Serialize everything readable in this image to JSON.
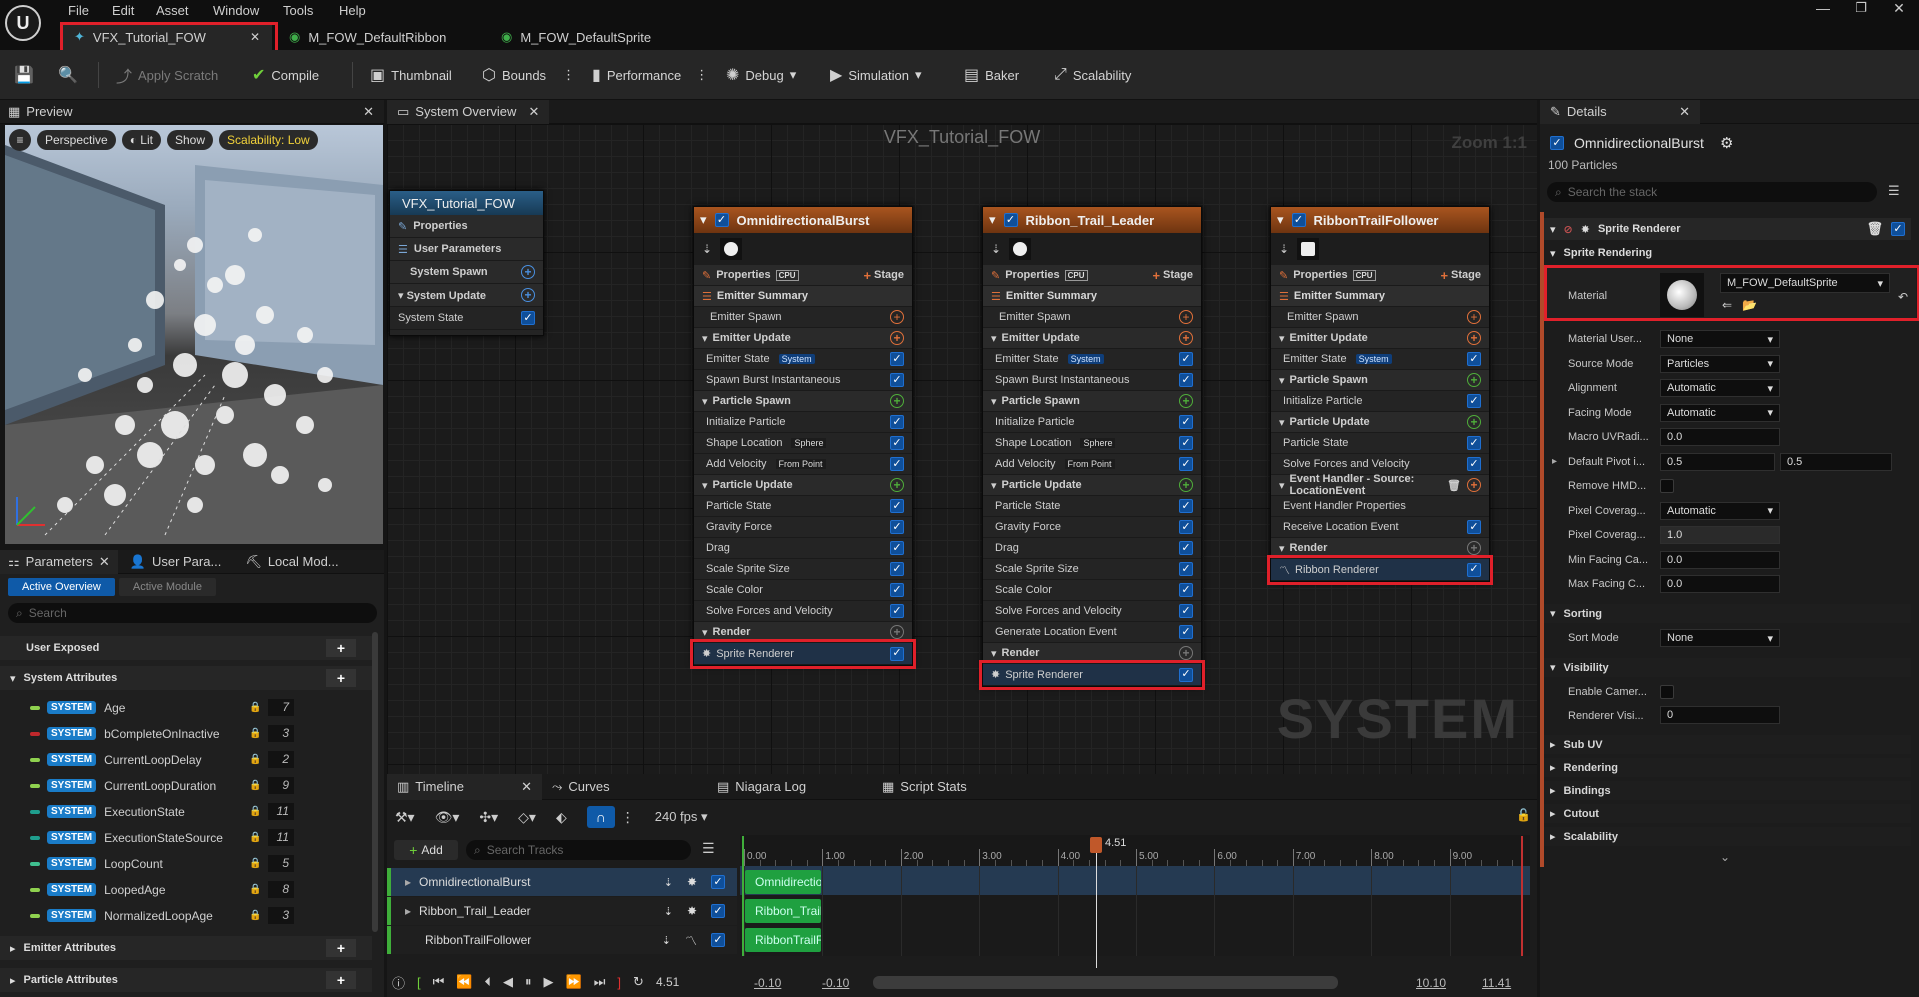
{
  "app": {
    "menu": [
      "File",
      "Edit",
      "Asset",
      "Window",
      "Tools",
      "Help"
    ],
    "tabs": [
      {
        "label": "VFX_Tutorial_FOW",
        "active": true
      },
      {
        "label": "M_FOW_DefaultRibbon",
        "active": false
      },
      {
        "label": "M_FOW_DefaultSprite",
        "active": false
      }
    ]
  },
  "toolbar": {
    "apply_scratch": "Apply Scratch",
    "compile": "Compile",
    "thumbnail": "Thumbnail",
    "bounds": "Bounds",
    "performance": "Performance",
    "debug": "Debug",
    "simulation": "Simulation",
    "baker": "Baker",
    "scalability": "Scalability"
  },
  "preview": {
    "title": "Preview",
    "perspective": "Perspective",
    "lit": "Lit",
    "show": "Show",
    "scalability": "Scalability: Low"
  },
  "parameters": {
    "tabs": [
      "Parameters",
      "User Para...",
      "Local Mod..."
    ],
    "subtabs": [
      "Active Overview",
      "Active Module"
    ],
    "search_placeholder": "Search",
    "user_exposed": "User Exposed",
    "system_attributes": "System Attributes",
    "badge": "SYSTEM",
    "attributes": [
      {
        "name": "Age",
        "value": "7",
        "color": "#8fd14f"
      },
      {
        "name": "bCompleteOnInactive",
        "value": "3",
        "color": "#c0282c"
      },
      {
        "name": "CurrentLoopDelay",
        "value": "2",
        "color": "#8fd14f"
      },
      {
        "name": "CurrentLoopDuration",
        "value": "9",
        "color": "#8fd14f"
      },
      {
        "name": "ExecutionState",
        "value": "11",
        "color": "#1f9e8e"
      },
      {
        "name": "ExecutionStateSource",
        "value": "11",
        "color": "#1f9e8e"
      },
      {
        "name": "LoopCount",
        "value": "5",
        "color": "#3fbf8f"
      },
      {
        "name": "LoopedAge",
        "value": "8",
        "color": "#8fd14f"
      },
      {
        "name": "NormalizedLoopAge",
        "value": "3",
        "color": "#8fd14f"
      }
    ],
    "emitter_attributes": "Emitter Attributes",
    "particle_attributes": "Particle Attributes"
  },
  "overview": {
    "tab": "System Overview",
    "graph_title": "VFX_Tutorial_FOW",
    "zoom": "Zoom 1:1",
    "watermark": "SYSTEM",
    "system_node": {
      "title": "VFX_Tutorial_FOW",
      "rows": [
        "Properties",
        "User Parameters",
        "System Spawn",
        "System Update",
        "System State"
      ]
    },
    "emitters": [
      {
        "title": "OmnidirectionalBurst",
        "properties": "Properties",
        "cpu": "CPU",
        "stage": "Stage",
        "rows": [
          {
            "t": "sec",
            "label": "Emitter Summary"
          },
          {
            "t": "item",
            "label": "Emitter Spawn",
            "plus": "r"
          },
          {
            "t": "grp",
            "label": "Emitter Update",
            "plus": "r"
          },
          {
            "t": "item",
            "label": "Emitter State",
            "pill": "System",
            "chk": true
          },
          {
            "t": "item",
            "label": "Spawn Burst Instantaneous",
            "chk": true
          },
          {
            "t": "grp",
            "label": "Particle Spawn",
            "plus": "g"
          },
          {
            "t": "item",
            "label": "Initialize Particle",
            "chk": true
          },
          {
            "t": "item",
            "label": "Shape Location",
            "pill2": "Sphere",
            "chk": true
          },
          {
            "t": "item",
            "label": "Add Velocity",
            "pill2": "From Point",
            "chk": true
          },
          {
            "t": "grp",
            "label": "Particle Update",
            "plus": "g"
          },
          {
            "t": "item",
            "label": "Particle State",
            "chk": true
          },
          {
            "t": "item",
            "label": "Gravity Force",
            "chk": true
          },
          {
            "t": "item",
            "label": "Drag",
            "chk": true
          },
          {
            "t": "item",
            "label": "Scale Sprite Size",
            "chk": true
          },
          {
            "t": "item",
            "label": "Scale Color",
            "chk": true
          },
          {
            "t": "item",
            "label": "Solve Forces and Velocity",
            "chk": true
          },
          {
            "t": "grp",
            "label": "Render",
            "plus": "gr"
          },
          {
            "t": "render",
            "label": "Sprite Renderer",
            "chk": true
          }
        ]
      },
      {
        "title": "Ribbon_Trail_Leader",
        "properties": "Properties",
        "cpu": "CPU",
        "stage": "Stage",
        "rows": [
          {
            "t": "sec",
            "label": "Emitter Summary"
          },
          {
            "t": "item",
            "label": "Emitter Spawn",
            "plus": "r"
          },
          {
            "t": "grp",
            "label": "Emitter Update",
            "plus": "r"
          },
          {
            "t": "item",
            "label": "Emitter State",
            "pill": "System",
            "chk": true
          },
          {
            "t": "item",
            "label": "Spawn Burst Instantaneous",
            "chk": true
          },
          {
            "t": "grp",
            "label": "Particle Spawn",
            "plus": "g"
          },
          {
            "t": "item",
            "label": "Initialize Particle",
            "chk": true
          },
          {
            "t": "item",
            "label": "Shape Location",
            "pill2": "Sphere",
            "chk": true
          },
          {
            "t": "item",
            "label": "Add Velocity",
            "pill2": "From Point",
            "chk": true
          },
          {
            "t": "grp",
            "label": "Particle Update",
            "plus": "g"
          },
          {
            "t": "item",
            "label": "Particle State",
            "chk": true
          },
          {
            "t": "item",
            "label": "Gravity Force",
            "chk": true
          },
          {
            "t": "item",
            "label": "Drag",
            "chk": true
          },
          {
            "t": "item",
            "label": "Scale Sprite Size",
            "chk": true
          },
          {
            "t": "item",
            "label": "Scale Color",
            "chk": true
          },
          {
            "t": "item",
            "label": "Solve Forces and Velocity",
            "chk": true
          },
          {
            "t": "item",
            "label": "Generate Location Event",
            "chk": true
          },
          {
            "t": "grp",
            "label": "Render",
            "plus": "gr"
          },
          {
            "t": "render",
            "label": "Sprite Renderer",
            "chk": true
          }
        ]
      },
      {
        "title": "RibbonTrailFollower",
        "properties": "Properties",
        "cpu": "CPU",
        "stage": "Stage",
        "rows": [
          {
            "t": "sec",
            "label": "Emitter Summary"
          },
          {
            "t": "item",
            "label": "Emitter Spawn",
            "plus": "r"
          },
          {
            "t": "grp",
            "label": "Emitter Update",
            "plus": "r"
          },
          {
            "t": "item",
            "label": "Emitter State",
            "pill": "System",
            "chk": true
          },
          {
            "t": "grp",
            "label": "Particle Spawn",
            "plus": "g"
          },
          {
            "t": "item",
            "label": "Initialize Particle",
            "chk": true
          },
          {
            "t": "grp",
            "label": "Particle Update",
            "plus": "g"
          },
          {
            "t": "item",
            "label": "Particle State",
            "chk": true
          },
          {
            "t": "item",
            "label": "Solve Forces and Velocity",
            "chk": true
          },
          {
            "t": "grp",
            "label": "Event Handler - Source: LocationEvent",
            "trash": true
          },
          {
            "t": "item",
            "label": "Event Handler Properties"
          },
          {
            "t": "item",
            "label": "Receive Location Event",
            "chk": true
          },
          {
            "t": "grp",
            "label": "Render",
            "plus": "gr"
          },
          {
            "t": "render",
            "label": "Ribbon Renderer",
            "chk": true
          }
        ]
      }
    ]
  },
  "timeline": {
    "tabs": [
      "Timeline",
      "Curves",
      "Niagara Log",
      "Script Stats"
    ],
    "fps": "240 fps",
    "add": "Add",
    "search_placeholder": "Search Tracks",
    "tracks": [
      "OmnidirectionalBurst",
      "Ribbon_Trail_Leader",
      "RibbonTrailFollower"
    ],
    "track_bars": [
      "OmnidirectionalBurst",
      "Ribbon_Trail_Leader",
      "RibbonTrailFollower"
    ],
    "ticks": [
      "0.00",
      "1.00",
      "2.00",
      "3.00",
      "4.00",
      "5.00",
      "6.00",
      "7.00",
      "8.00",
      "9.00"
    ],
    "playhead": "4.51",
    "current_time": "4.51",
    "range_start": "-0.10",
    "view_start": "-0.10",
    "view_end": "10.10",
    "range_end": "11.41"
  },
  "details": {
    "title": "Details",
    "emitter": "OmnidirectionalBurst",
    "particles": "100 Particles",
    "search_placeholder": "Search the stack",
    "renderer": "Sprite Renderer",
    "sprite_rendering": "Sprite Rendering",
    "material_label": "Material",
    "material_value": "M_FOW_DefaultSprite",
    "props": [
      {
        "label": "Material User...",
        "value": "None",
        "type": "drop"
      },
      {
        "label": "Source Mode",
        "value": "Particles",
        "type": "drop"
      },
      {
        "label": "Alignment",
        "value": "Automatic",
        "type": "drop"
      },
      {
        "label": "Facing Mode",
        "value": "Automatic",
        "type": "drop"
      },
      {
        "label": "Macro UVRadi...",
        "value": "0.0",
        "type": "val"
      },
      {
        "label": "Default Pivot i...",
        "value": "0.5",
        "value2": "0.5",
        "type": "pair"
      },
      {
        "label": "Remove HMD...",
        "type": "chk"
      },
      {
        "label": "Pixel Coverag...",
        "value": "Automatic",
        "type": "drop"
      },
      {
        "label": "Pixel Coverag...",
        "value": "1.0",
        "type": "val"
      },
      {
        "label": "Min Facing Ca...",
        "value": "0.0",
        "type": "val"
      },
      {
        "label": "Max Facing C...",
        "value": "0.0",
        "type": "val"
      }
    ],
    "sorting": "Sorting",
    "sort_mode_label": "Sort Mode",
    "sort_mode_value": "None",
    "visibility": "Visibility",
    "enable_camera": "Enable Camer...",
    "renderer_vis": "Renderer Visi...",
    "renderer_vis_value": "0",
    "sections": [
      "Sub UV",
      "Rendering",
      "Bindings",
      "Cutout",
      "Scalability"
    ]
  }
}
